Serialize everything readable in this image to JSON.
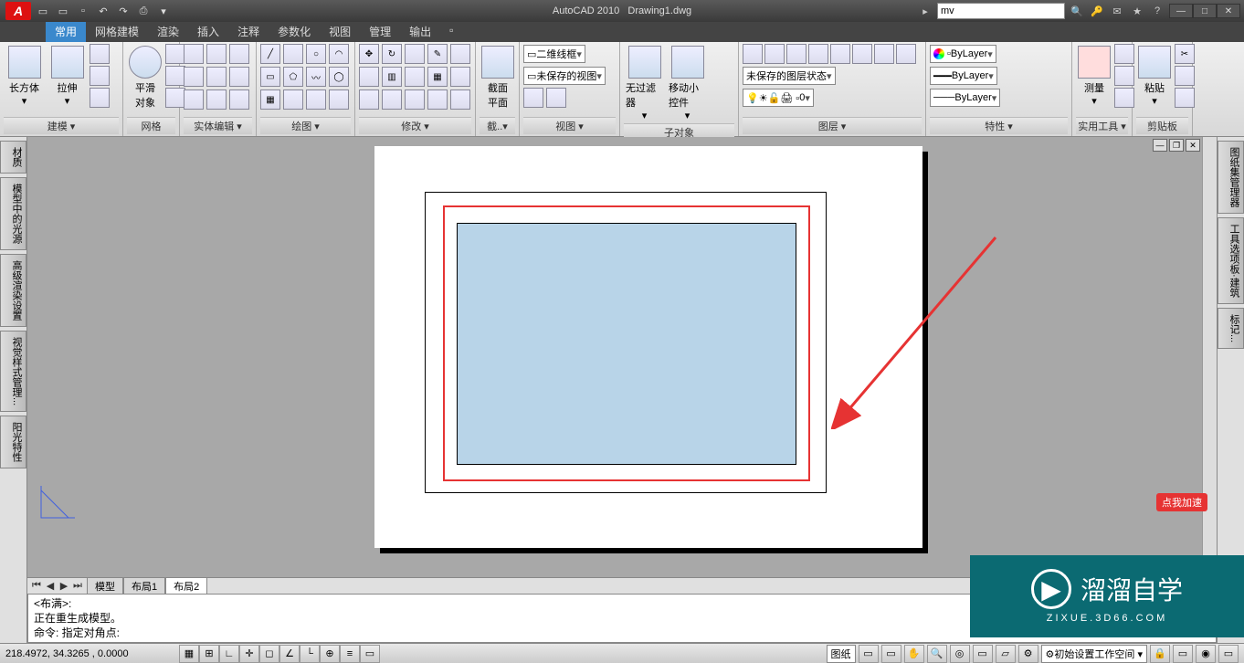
{
  "title": {
    "app": "AutoCAD 2010",
    "doc": "Drawing1.dwg"
  },
  "search_value": "mv",
  "ribbon_tabs": [
    "常用",
    "网格建模",
    "渲染",
    "插入",
    "注释",
    "参数化",
    "视图",
    "管理",
    "输出"
  ],
  "active_tab_index": 0,
  "panels": {
    "modeling": {
      "label": "建模 ▾",
      "box": "长方体",
      "extrude": "拉伸"
    },
    "mesh": {
      "label": "网格",
      "smooth": "平滑\n对象"
    },
    "solidedit": {
      "label": "实体编辑 ▾"
    },
    "draw": {
      "label": "绘图 ▾"
    },
    "modify": {
      "label": "修改 ▾"
    },
    "section": {
      "label": "截..▾",
      "btn": "截面\n平面"
    },
    "view": {
      "label": "视图 ▾",
      "vs": "二维线框",
      "vstate": "未保存的视图"
    },
    "subobj": {
      "label": "子对象",
      "filter": "无过滤器",
      "gizmo": "移动小控件"
    },
    "layers": {
      "label": "图层 ▾",
      "state": "未保存的图层状态",
      "current": "0"
    },
    "props": {
      "label": "特性 ▾",
      "layer": "ByLayer",
      "lt": "ByLayer",
      "lw": "ByLayer"
    },
    "measure": {
      "label": "测量",
      "btn": "测量"
    },
    "utilities": {
      "label": "实用工具 ▾"
    },
    "clipboard": {
      "label": "剪贴板",
      "btn": "粘贴"
    }
  },
  "side_left": [
    "材质",
    "模型中的光源",
    "高级渲染设置",
    "视觉样式管理...",
    "阳光特性"
  ],
  "side_right": [
    "图纸集管理器",
    "工具选项板·建筑",
    "标记..."
  ],
  "layout_tabs": [
    "模型",
    "布局1",
    "布局2"
  ],
  "active_layout_index": 2,
  "cmd": {
    "l1": "<布满>:",
    "l2": "正在重生成模型。",
    "l3": "命令: 指定对角点:"
  },
  "coords": "218.4972, 34.3265 , 0.0000",
  "status_right": {
    "paper": "图纸",
    "ws": "初始设置工作空间"
  },
  "logo": {
    "main": "溜溜自学",
    "sub": "ZIXUE.3D66.COM"
  },
  "accel": "点我加速"
}
